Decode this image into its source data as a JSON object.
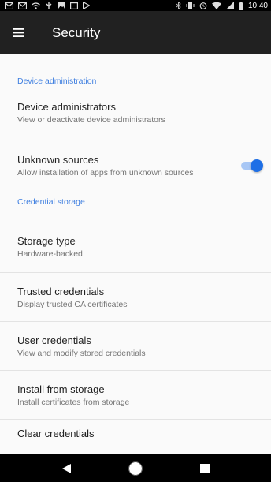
{
  "status_bar": {
    "left_icons": [
      "gmail-icon",
      "gmail-icon",
      "wifi-icon",
      "usb-icon",
      "image-icon",
      "tablet-icon",
      "play-store-icon"
    ],
    "right_icons": [
      "bluetooth-icon",
      "vibrate-icon",
      "alarm-icon",
      "wifi-signal-icon",
      "cell-signal-icon",
      "battery-icon"
    ],
    "time": "10:40"
  },
  "toolbar": {
    "title": "Security",
    "menu_icon": "hamburger-menu-icon"
  },
  "sections": [
    {
      "category": "Device administration",
      "items": [
        {
          "title": "Device administrators",
          "summary": "View or deactivate device administrators"
        },
        {
          "title": "Unknown sources",
          "summary": "Allow installation of apps from unknown sources",
          "toggle": true
        }
      ]
    },
    {
      "category": "Credential storage",
      "items": [
        {
          "title": "Storage type",
          "summary": "Hardware-backed"
        },
        {
          "title": "Trusted credentials",
          "summary": "Display trusted CA certificates"
        },
        {
          "title": "User credentials",
          "summary": "View and modify stored credentials"
        },
        {
          "title": "Install from storage",
          "summary": "Install certificates from storage"
        },
        {
          "title": "Clear credentials",
          "summary": ""
        }
      ]
    }
  ],
  "colors": {
    "accent": "#3f7fe0",
    "toolbar": "#212121",
    "toggle_thumb": "#1e6fe6",
    "toggle_track": "#a8c7f5"
  },
  "nav_bar": {
    "icons": [
      "back-icon",
      "home-icon",
      "recents-icon"
    ]
  }
}
